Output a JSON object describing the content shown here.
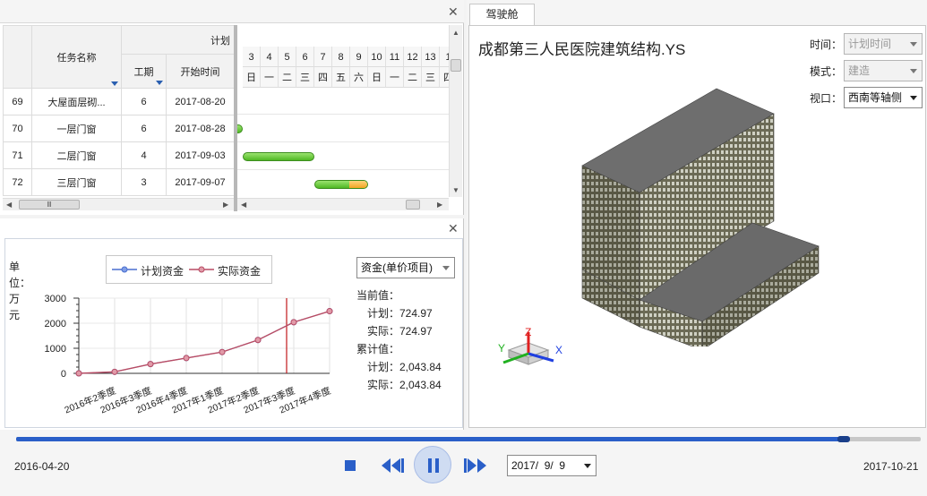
{
  "gantt": {
    "col_task": "任务名称",
    "col_group": "计划",
    "col_duration": "工期",
    "col_start": "开始时间",
    "days": [
      "3",
      "4",
      "5",
      "6",
      "7",
      "8",
      "9",
      "10",
      "11",
      "12",
      "13",
      "1"
    ],
    "weekdays": [
      "日",
      "一",
      "二",
      "三",
      "四",
      "五",
      "六",
      "日",
      "一",
      "二",
      "三",
      "四"
    ],
    "rows": [
      {
        "id": "69",
        "name": "大屋面层砌...",
        "duration": "6",
        "start": "2017-08-20"
      },
      {
        "id": "70",
        "name": "一层门窗",
        "duration": "6",
        "start": "2017-08-28"
      },
      {
        "id": "71",
        "name": "二层门窗",
        "duration": "4",
        "start": "2017-09-03"
      },
      {
        "id": "72",
        "name": "三层门窗",
        "duration": "3",
        "start": "2017-09-07"
      }
    ],
    "scroll_grip": "Ⅲ"
  },
  "funds": {
    "unit_label": "单位：万元",
    "legend_plan": "计划资金",
    "legend_actual": "实际资金",
    "selector": "资金(单价项目)",
    "current_title": "当前值：",
    "current_plan": "计划：724.97",
    "current_actual": "实际：724.97",
    "cumulative_title": "累计值：",
    "cumulative_plan": "计划：2,043.84",
    "cumulative_actual": "实际：2,043.84",
    "colors": {
      "plan": "#4a6fd0",
      "actual": "#b84c64",
      "marker": "#c0181c"
    }
  },
  "chart_data": {
    "type": "line",
    "categories": [
      "",
      "2016年2季度",
      "2016年3季度",
      "2016年4季度",
      "2017年1季度",
      "2017年2季度",
      "2017年3季度",
      "2017年4季度"
    ],
    "yticks": [
      "3000",
      "2000",
      "1000",
      "0"
    ],
    "ylim": [
      0,
      3000
    ],
    "series": [
      {
        "name": "计划资金",
        "values": [
          0,
          60,
          370,
          610,
          850,
          1330,
          2040,
          2480
        ]
      },
      {
        "name": "实际资金",
        "values": [
          0,
          60,
          370,
          610,
          850,
          1330,
          2040,
          2480
        ]
      }
    ],
    "current_marker_index": 5.8
  },
  "cockpit": {
    "tab": "驾驶舱",
    "title": "成都第三人民医院建筑结构.YS",
    "time_label": "时间：",
    "time_value": "计划时间",
    "mode_label": "模式：",
    "mode_value": "建造",
    "view_label": "视口：",
    "view_value": "西南等轴侧",
    "axis_x": "X",
    "axis_y": "Y",
    "axis_z": "Z"
  },
  "player": {
    "start_date": "2016-04-20",
    "end_date": "2017-10-21",
    "current_date": "2017/  9/  9",
    "progress": 0.915
  }
}
